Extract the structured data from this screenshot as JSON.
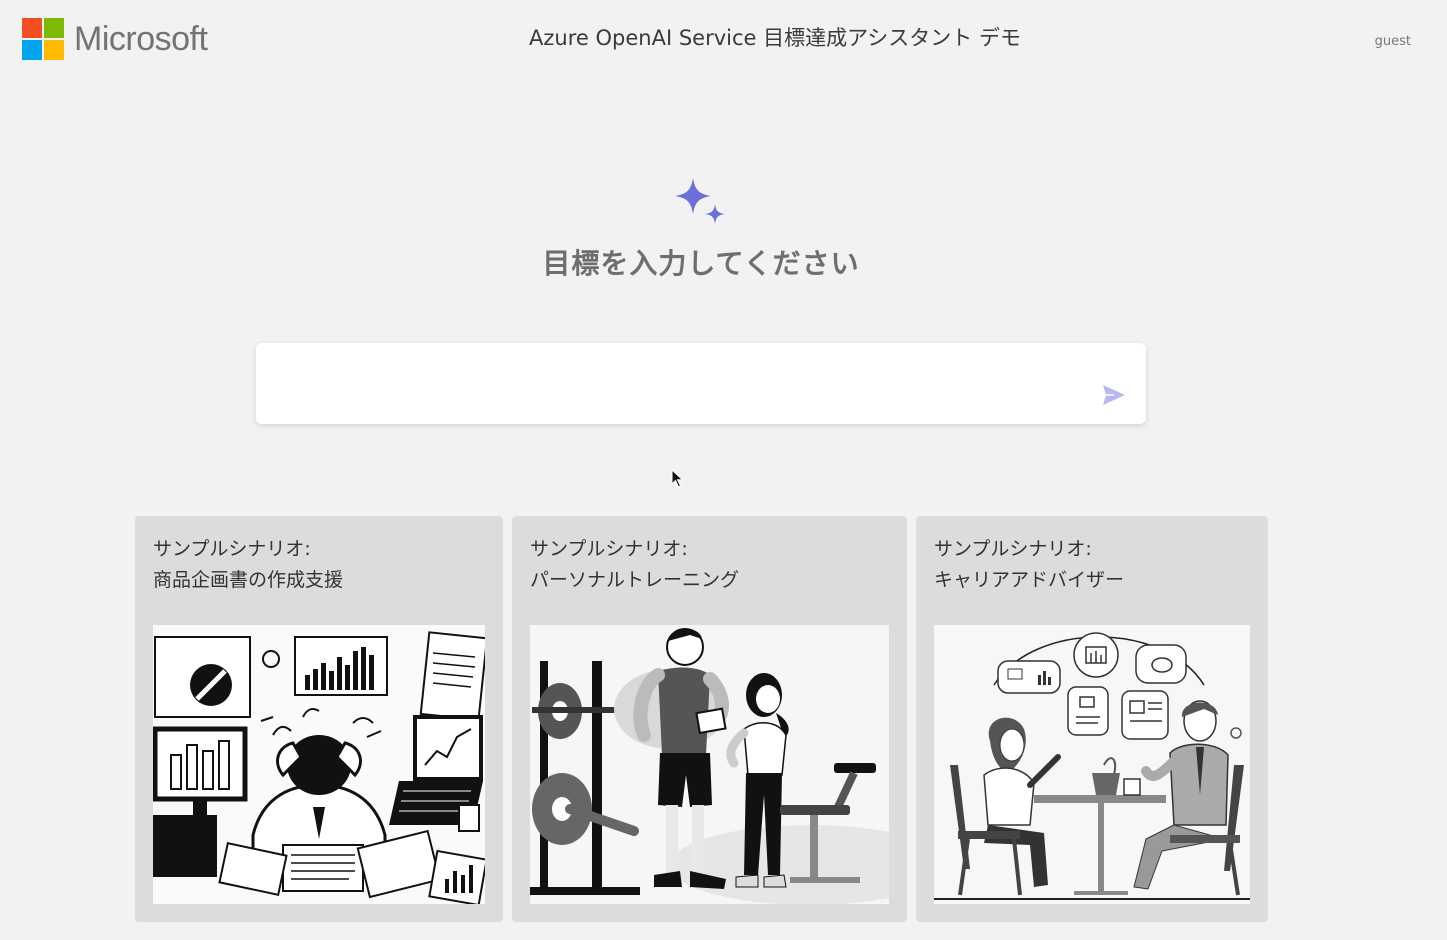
{
  "header": {
    "brand": "Microsoft",
    "title": "Azure OpenAI Service 目標達成アシスタント デモ",
    "user": "guest"
  },
  "hero": {
    "prompt": "目標を入力してください",
    "accent_color": "#6b6fd8"
  },
  "input": {
    "value": "",
    "send_icon": "send-icon"
  },
  "cards": [
    {
      "line1": "サンプルシナリオ:",
      "line2": "商品企画書の作成支援",
      "illustration": "stressed-office-worker"
    },
    {
      "line1": "サンプルシナリオ:",
      "line2": "パーソナルトレーニング",
      "illustration": "gym-trainer"
    },
    {
      "line1": "サンプルシナリオ:",
      "line2": "キャリアアドバイザー",
      "illustration": "career-consultation"
    }
  ]
}
